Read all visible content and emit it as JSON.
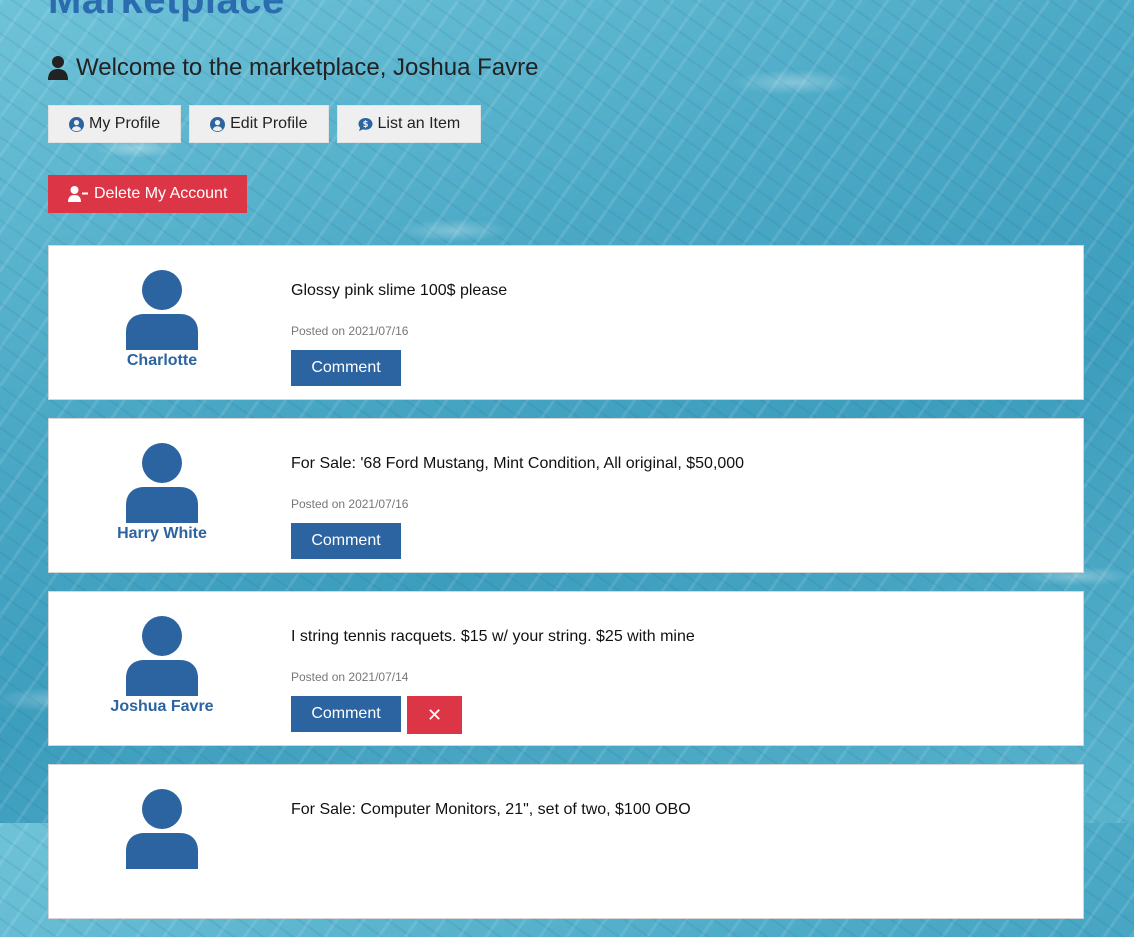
{
  "header": {
    "title": "Marketplace",
    "welcome": "Welcome to the marketplace, Joshua Favre"
  },
  "nav": {
    "my_profile": "My Profile",
    "edit_profile": "Edit Profile",
    "list_item": "List an Item",
    "delete_account": "Delete My Account"
  },
  "posts": [
    {
      "author": "Charlotte",
      "text": "Glossy pink slime 100$ please",
      "posted_label": "Posted on",
      "date": "2021/07/16",
      "comment": "Comment",
      "deletable": false
    },
    {
      "author": "Harry White",
      "text": "For Sale: '68 Ford Mustang, Mint Condition, All original, $50,000",
      "posted_label": "Posted on",
      "date": "2021/07/16",
      "comment": "Comment",
      "deletable": false
    },
    {
      "author": "Joshua Favre",
      "text": "I string tennis racquets. $15 w/ your string. $25 with mine",
      "posted_label": "Posted on",
      "date": "2021/07/14",
      "comment": "Comment",
      "deletable": true,
      "delete_glyph": "✕"
    },
    {
      "author": "",
      "text": "For Sale: Computer Monitors, 21\", set of two, $100 OBO",
      "posted_label": "",
      "date": "",
      "comment": "",
      "deletable": false
    }
  ],
  "icons": {
    "user": "user-icon",
    "profile": "user-circle-icon",
    "list": "dollar-comment-icon",
    "delete_account": "user-minus-icon"
  },
  "colors": {
    "brand_blue": "#2b64a0",
    "danger": "#dc3545"
  }
}
